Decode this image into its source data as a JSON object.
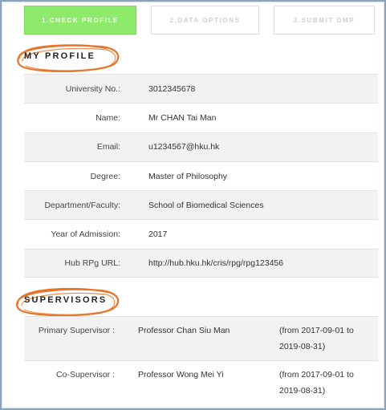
{
  "steps": [
    {
      "label": "1.Check Profile",
      "active": true
    },
    {
      "label": "2.Data Options",
      "active": false
    },
    {
      "label": "3.Submit DMP",
      "active": false
    }
  ],
  "profile": {
    "title": "MY PROFILE",
    "rows": [
      {
        "label": "University No.:",
        "value": "3012345678"
      },
      {
        "label": "Name:",
        "value": "Mr CHAN Tai Man"
      },
      {
        "label": "Email:",
        "value": "u1234567@hku.hk"
      },
      {
        "label": "Degree:",
        "value": "Master of Philosophy"
      },
      {
        "label": "Department/Faculty:",
        "value": "School of Biomedical Sciences"
      },
      {
        "label": "Year of Admission:",
        "value": "2017"
      },
      {
        "label": "Hub RPg URL:",
        "value": "http://hub.hku.hk/cris/rpg/rpg123456"
      }
    ]
  },
  "supervisors": {
    "title": "SUPERVISORS",
    "rows": [
      {
        "role": "Primary Supervisor :",
        "name": "Professor Chan Siu Man",
        "period_line1": "(from 2017-09-01 to",
        "period_line2": "2019-08-31)"
      },
      {
        "role": "Co-Supervisor :",
        "name": "Professor Wong Mei Yi",
        "period_line1": "(from 2017-09-01 to",
        "period_line2": "2019-08-31)"
      }
    ]
  },
  "colors": {
    "active_step": "#8eea6a",
    "circle_stroke": "#e8742a",
    "frame_border": "#8aa4bd"
  }
}
